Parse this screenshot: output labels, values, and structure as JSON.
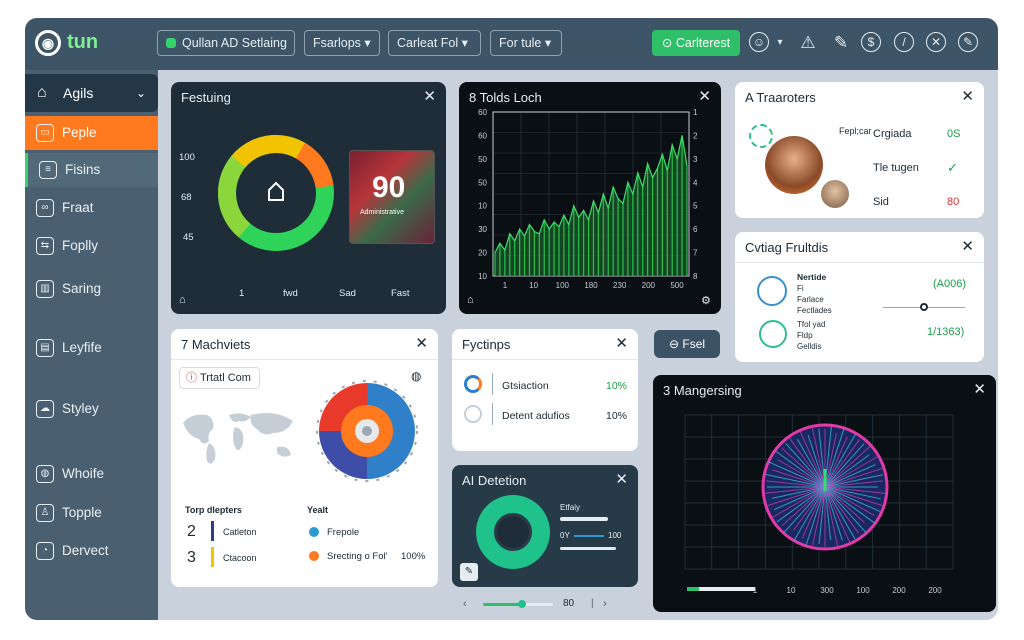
{
  "topbar": {
    "logo_text": "tun",
    "logo_icon": "ring-logo",
    "buttons": [
      {
        "label": "Qullan AD Setlaing"
      },
      {
        "label": "Fsarlops"
      },
      {
        "label": "Carleat Fol"
      },
      {
        "label": "For tule"
      }
    ],
    "primary_button": "Carlterest",
    "icons": [
      "emoji-icon",
      "alert-icon",
      "pen-icon",
      "dollar-icon",
      "compass-icon",
      "close-circle-icon",
      "edit-circle-icon"
    ]
  },
  "sidebar": {
    "head": "Agils",
    "items": [
      {
        "label": "Peple",
        "icon": "card-icon"
      },
      {
        "label": "Fisins",
        "icon": "list-icon"
      },
      {
        "label": "Fraat",
        "icon": "people-icon"
      },
      {
        "label": "Foplly",
        "icon": "share-icon"
      },
      {
        "label": "Saring",
        "icon": "building-icon"
      },
      {
        "label": "Leyfife",
        "icon": "book-icon"
      },
      {
        "label": "Styley",
        "icon": "cloud-icon"
      },
      {
        "label": "Whoife",
        "icon": "globe-icon"
      },
      {
        "label": "Topple",
        "icon": "person-icon"
      },
      {
        "label": "Dervect",
        "icon": "clock-icon"
      }
    ]
  },
  "feature_panel": {
    "title": "Festuing",
    "yticks": [
      "100",
      "68",
      "45"
    ],
    "xticks": [
      "1",
      "fwd",
      "Sad",
      "Fast"
    ],
    "big_number": "90",
    "inner_caption": "Administrative",
    "donut_colors": [
      "#ff7a1f",
      "#f2c300",
      "#8bd63a",
      "#2fd35a"
    ]
  },
  "line_panel": {
    "title": "8 Tolds Loch",
    "yticks": [
      "60",
      "60",
      "50",
      "50",
      "10",
      "30",
      "20",
      "10"
    ],
    "xticks": [
      "1",
      "10",
      "100",
      "180",
      "230",
      "200",
      "500"
    ]
  },
  "chart_data": {
    "type": "line",
    "title": "8 Tolds Loch",
    "x": [
      0,
      1,
      2,
      3,
      4,
      5,
      6,
      7,
      8,
      9,
      10,
      11,
      12,
      13,
      14,
      15,
      16,
      17,
      18,
      19,
      20,
      21,
      22,
      23,
      24,
      25,
      26,
      27,
      28,
      29,
      30,
      31,
      32,
      33,
      34,
      35,
      36,
      37,
      38,
      39
    ],
    "series": [
      {
        "values": [
          10,
          14,
          11,
          18,
          15,
          20,
          17,
          22,
          19,
          18,
          24,
          20,
          23,
          21,
          26,
          22,
          30,
          25,
          28,
          24,
          32,
          27,
          35,
          29,
          38,
          33,
          31,
          40,
          35,
          44,
          38,
          48,
          42,
          46,
          52,
          45,
          56,
          50,
          60,
          47
        ]
      }
    ],
    "ylim": [
      0,
      70
    ],
    "grid": true
  },
  "traffic_panel": {
    "title": "A Traaroters",
    "label_a": "Fepl;car",
    "rows": [
      {
        "name": "Crgiada",
        "value": "0S"
      },
      {
        "name": "Tle tugen",
        "value": "✓"
      },
      {
        "name": "Sid",
        "value": "80"
      }
    ]
  },
  "outline_panel": {
    "title": "Cvtiag Frultdis",
    "items": [
      {
        "l1": "Nertide",
        "l2": "Fi",
        "l3": "Farlace",
        "l4": "Fectlades",
        "value": "(A006)"
      },
      {
        "l1": "Tfol yad",
        "l2": "Fldp",
        "l3": "Gelldis",
        "value": "1/1363)"
      }
    ]
  },
  "tool_button": "Fsel",
  "machines_panel": {
    "title": "7 Machviets",
    "chip": "Trtatl Com",
    "col1_title": "Torp dlepters",
    "col2_title": "Yealt",
    "rows1": [
      {
        "num": "2",
        "label": "Catleton"
      },
      {
        "num": "3",
        "label": "Ctacoon"
      }
    ],
    "rows2": [
      {
        "label": "Frepole"
      },
      {
        "label": "Srecting o Fol'",
        "value": "100%"
      }
    ]
  },
  "options_panel": {
    "title": "Fyctinps",
    "rows": [
      {
        "label": "Gtsiaction",
        "value": "10%"
      },
      {
        "label": "Detent adufios",
        "value": "10%"
      }
    ]
  },
  "ai_panel": {
    "title": "AI Detetion",
    "val_label": "Etfaiy",
    "num": "100",
    "small": "0Y"
  },
  "pager": {
    "value": "80"
  },
  "radar_panel": {
    "title": "3 Mangersing",
    "xticks": [
      "1",
      "10",
      "300",
      "100",
      "200",
      "200"
    ]
  }
}
